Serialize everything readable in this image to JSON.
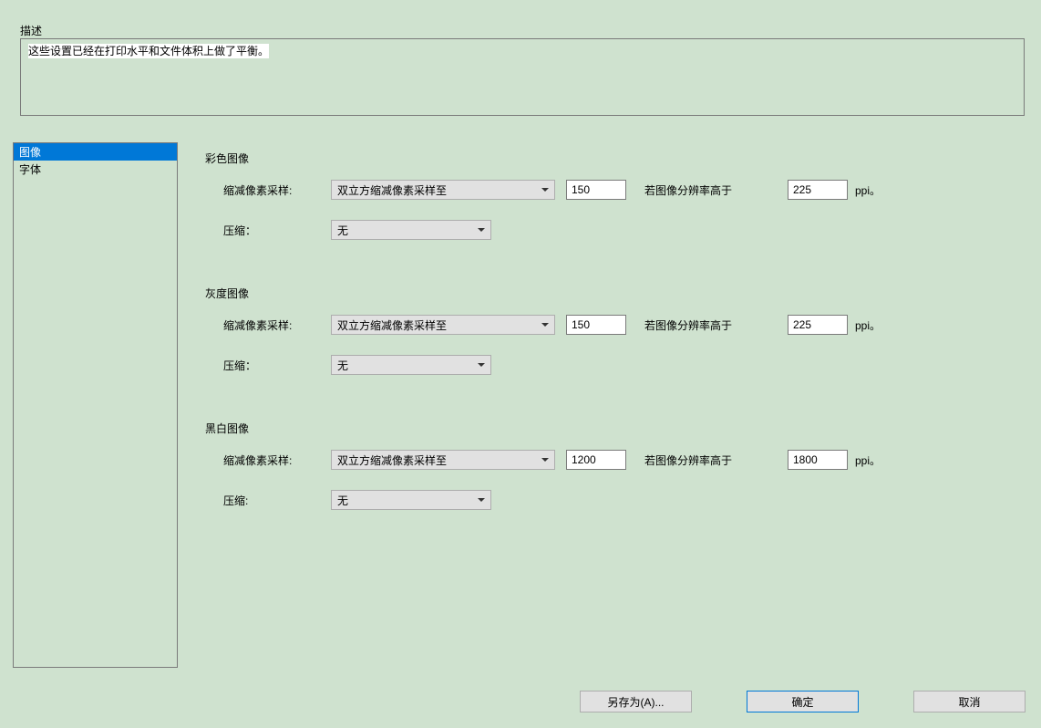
{
  "description": {
    "label": "描述",
    "text": "这些设置已经在打印水平和文件体积上做了平衡。"
  },
  "sidebar": {
    "items": [
      {
        "label": "图像",
        "selected": true
      },
      {
        "label": "字体",
        "selected": false
      }
    ]
  },
  "sections": {
    "color": {
      "title": "彩色图像",
      "downsample": {
        "label": "缩减像素采样:",
        "method": "双立方缩减像素采样至",
        "value": "150",
        "threshold_label": "若图像分辨率高于",
        "threshold_value": "225",
        "unit": "ppi。"
      },
      "compression": {
        "label": "压缩：",
        "value": "无"
      }
    },
    "gray": {
      "title": "灰度图像",
      "downsample": {
        "label": "缩减像素采样:",
        "method": "双立方缩减像素采样至",
        "value": "150",
        "threshold_label": "若图像分辨率高于",
        "threshold_value": "225",
        "unit": "ppi。"
      },
      "compression": {
        "label": "压缩：",
        "value": "无"
      }
    },
    "mono": {
      "title": "黑白图像",
      "downsample": {
        "label": "缩减像素采样:",
        "method": "双立方缩减像素采样至",
        "value": "1200",
        "threshold_label": "若图像分辨率高于",
        "threshold_value": "1800",
        "unit": "ppi。"
      },
      "compression": {
        "label": "压缩:",
        "value": "无"
      }
    }
  },
  "buttons": {
    "save_as": "另存为(A)...",
    "ok": "确定",
    "cancel": "取消"
  }
}
